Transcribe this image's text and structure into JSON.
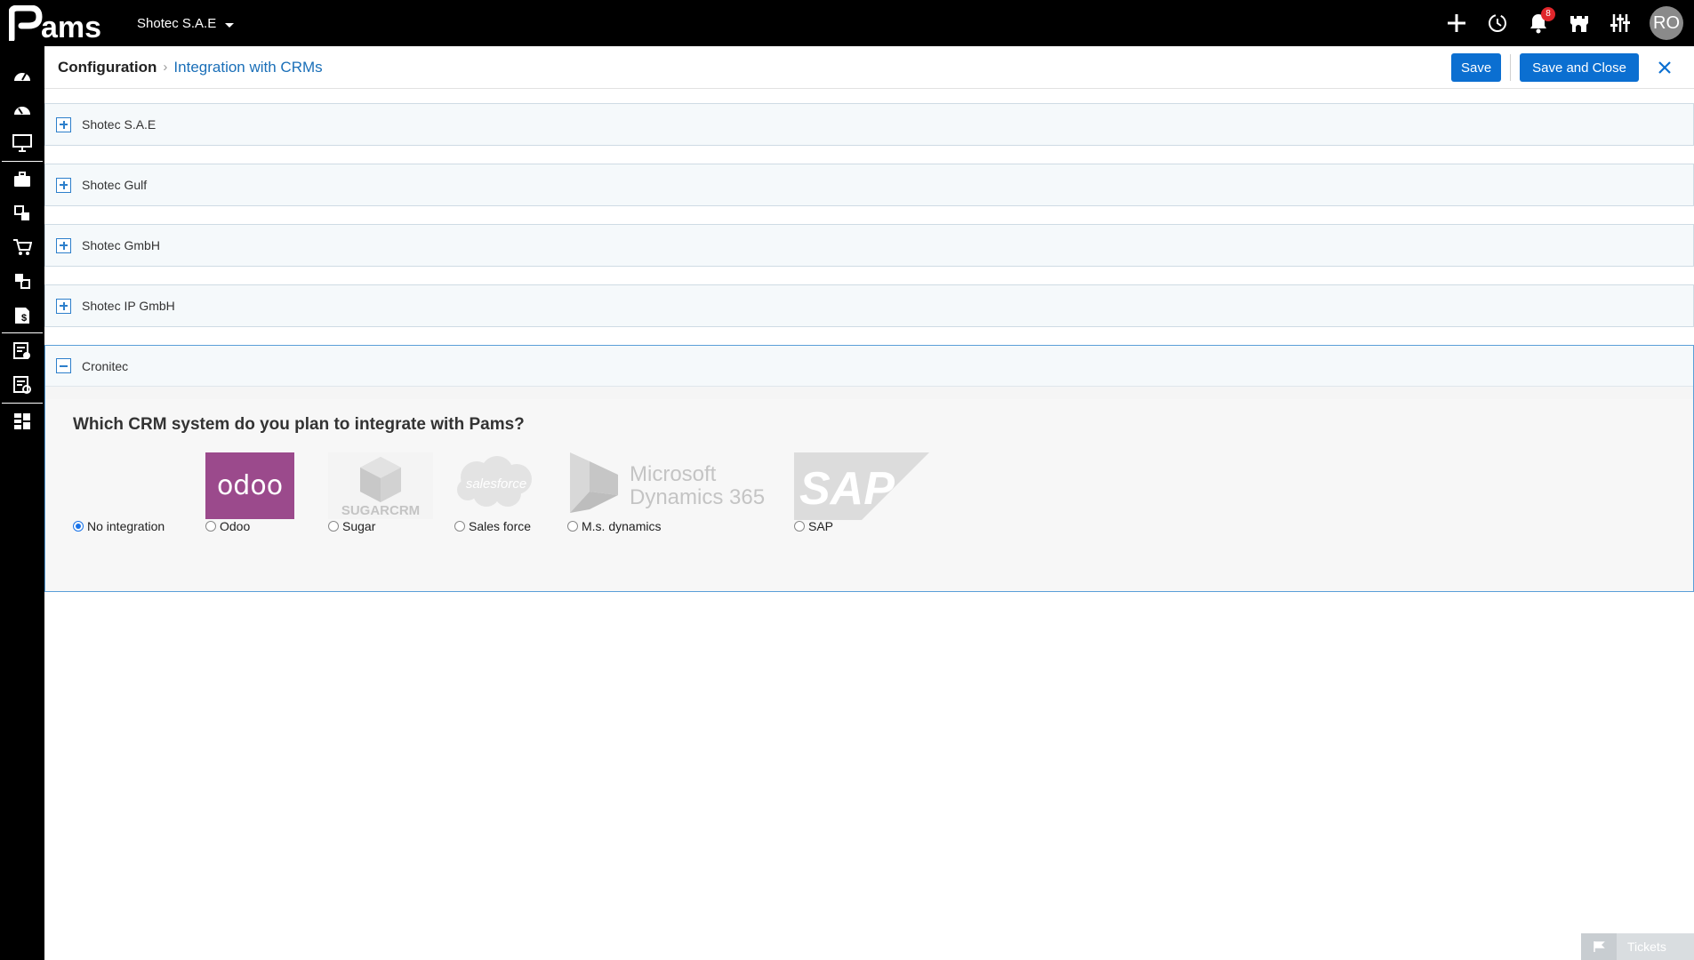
{
  "app": {
    "logo_text": "Pams"
  },
  "topbar": {
    "company": "Shotec S.A.E",
    "notification_count": "8",
    "avatar_initials": "RO",
    "icons": [
      "plus-icon",
      "history-icon",
      "bell-icon",
      "castle-icon",
      "sliders-icon"
    ]
  },
  "sidebar": {
    "icons": [
      "dashboard-icon",
      "dashboard-alt-icon",
      "monitor-icon",
      "briefcase-icon",
      "modules-icon",
      "cart-icon",
      "modules-alt-icon",
      "invoice-icon",
      "document-check-icon",
      "document-settings-icon",
      "grid-list-icon"
    ]
  },
  "header": {
    "breadcrumb_root": "Configuration",
    "breadcrumb_current": "Integration with CRMs",
    "save_label": "Save",
    "save_close_label": "Save and Close"
  },
  "companies": [
    {
      "name": "Shotec S.A.E",
      "expanded": false
    },
    {
      "name": "Shotec Gulf",
      "expanded": false
    },
    {
      "name": "Shotec GmbH",
      "expanded": false
    },
    {
      "name": "Shotec IP GmbH",
      "expanded": false
    },
    {
      "name": "Cronitec",
      "expanded": true
    }
  ],
  "crm": {
    "question": "Which CRM system do you plan to integrate with Pams?",
    "selected": "No integration",
    "options": [
      {
        "label": "No integration",
        "logo": ""
      },
      {
        "label": "Odoo",
        "logo": "odoo"
      },
      {
        "label": "Sugar",
        "logo": "SUGARCRM"
      },
      {
        "label": "Sales force",
        "logo": "salesforce"
      },
      {
        "label": "M.s. dynamics",
        "logo_line1": "Microsoft",
        "logo_line2": "Dynamics 365"
      },
      {
        "label": "SAP",
        "logo": "SAP"
      }
    ]
  },
  "footer": {
    "tickets_label": "Tickets"
  },
  "colors": {
    "primary": "#0b6fd1",
    "odoo": "#9b4a8c",
    "link": "#1a6fb8"
  }
}
